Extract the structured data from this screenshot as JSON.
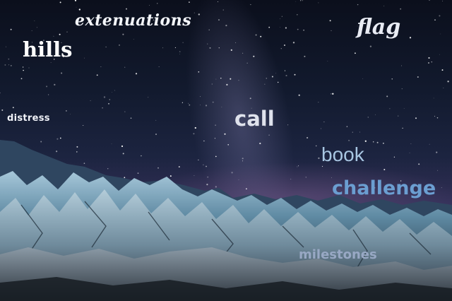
{
  "scene": {
    "description_colors": {
      "sky_top": "#0b0f1c",
      "horizon_glow": "#3a3560",
      "ice_light": "#9fc4d6",
      "ice_dark": "#1e2c3a"
    }
  },
  "words": {
    "extenuations": "extenuations",
    "flag": "flag",
    "hills": "hills",
    "distress": "distress",
    "call": "call",
    "book": "book",
    "challenge": "challenge",
    "milestones": "milestones"
  }
}
